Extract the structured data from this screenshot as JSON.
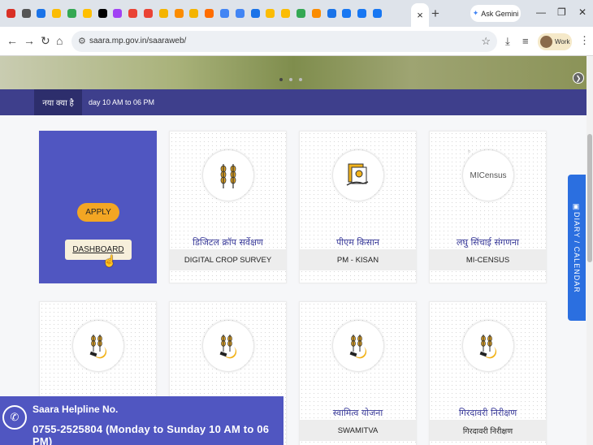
{
  "browser": {
    "active_tab_close": "×",
    "new_tab": "+",
    "ask_gemini": "Ask Gemini",
    "url": "saara.mp.gov.in/saaraweb/",
    "profile_label": "Work",
    "tab_favicons": [
      "#d93025",
      "#555",
      "#1a73e8",
      "#fbbc04",
      "#34a853",
      "#ffbf00",
      "#000",
      "#a142f4",
      "#ea4335",
      "#ea4335",
      "#f4b400",
      "#fb8c00",
      "#f4b400",
      "#ff6d00",
      "#4285f4",
      "#4285f4",
      "#1a73e8",
      "#fbbc04",
      "#fbbc04",
      "#34a853",
      "#fb8c00",
      "#1a73e8",
      "#1877f2",
      "#1877f2",
      "#1877f2"
    ]
  },
  "ticker": {
    "label": "नया क्या है",
    "text": "day 10 AM to 06 PM"
  },
  "cards": [
    {
      "type": "apply",
      "apply_label": "APPLY",
      "dashboard_label": "DASHBOARD"
    },
    {
      "hindi": "डिजिटल क्रॉप सर्वेक्षण",
      "eng": "DIGITAL CROP SURVEY"
    },
    {
      "hindi": "पीएम किसान",
      "eng": "PM - KISAN"
    },
    {
      "hindi": "लघु सिंचाई संगणना",
      "eng": "MI-CENSUS",
      "image_alt": "MICensus"
    },
    {
      "hindi": "",
      "eng": ""
    },
    {
      "hindi": "",
      "eng": ""
    },
    {
      "hindi": "स्वामित्व योजना",
      "eng": "SWAMITVA"
    },
    {
      "hindi": "गिरदावरी निरीक्षण",
      "eng": "गिरदावरी निरीक्षण"
    }
  ],
  "side_tab": "DIARY / CALENDAR",
  "helpline": {
    "title": "Saara Helpline No.",
    "number": "0755-2525804 (Monday to Sunday 10 AM to 06 PM)"
  }
}
